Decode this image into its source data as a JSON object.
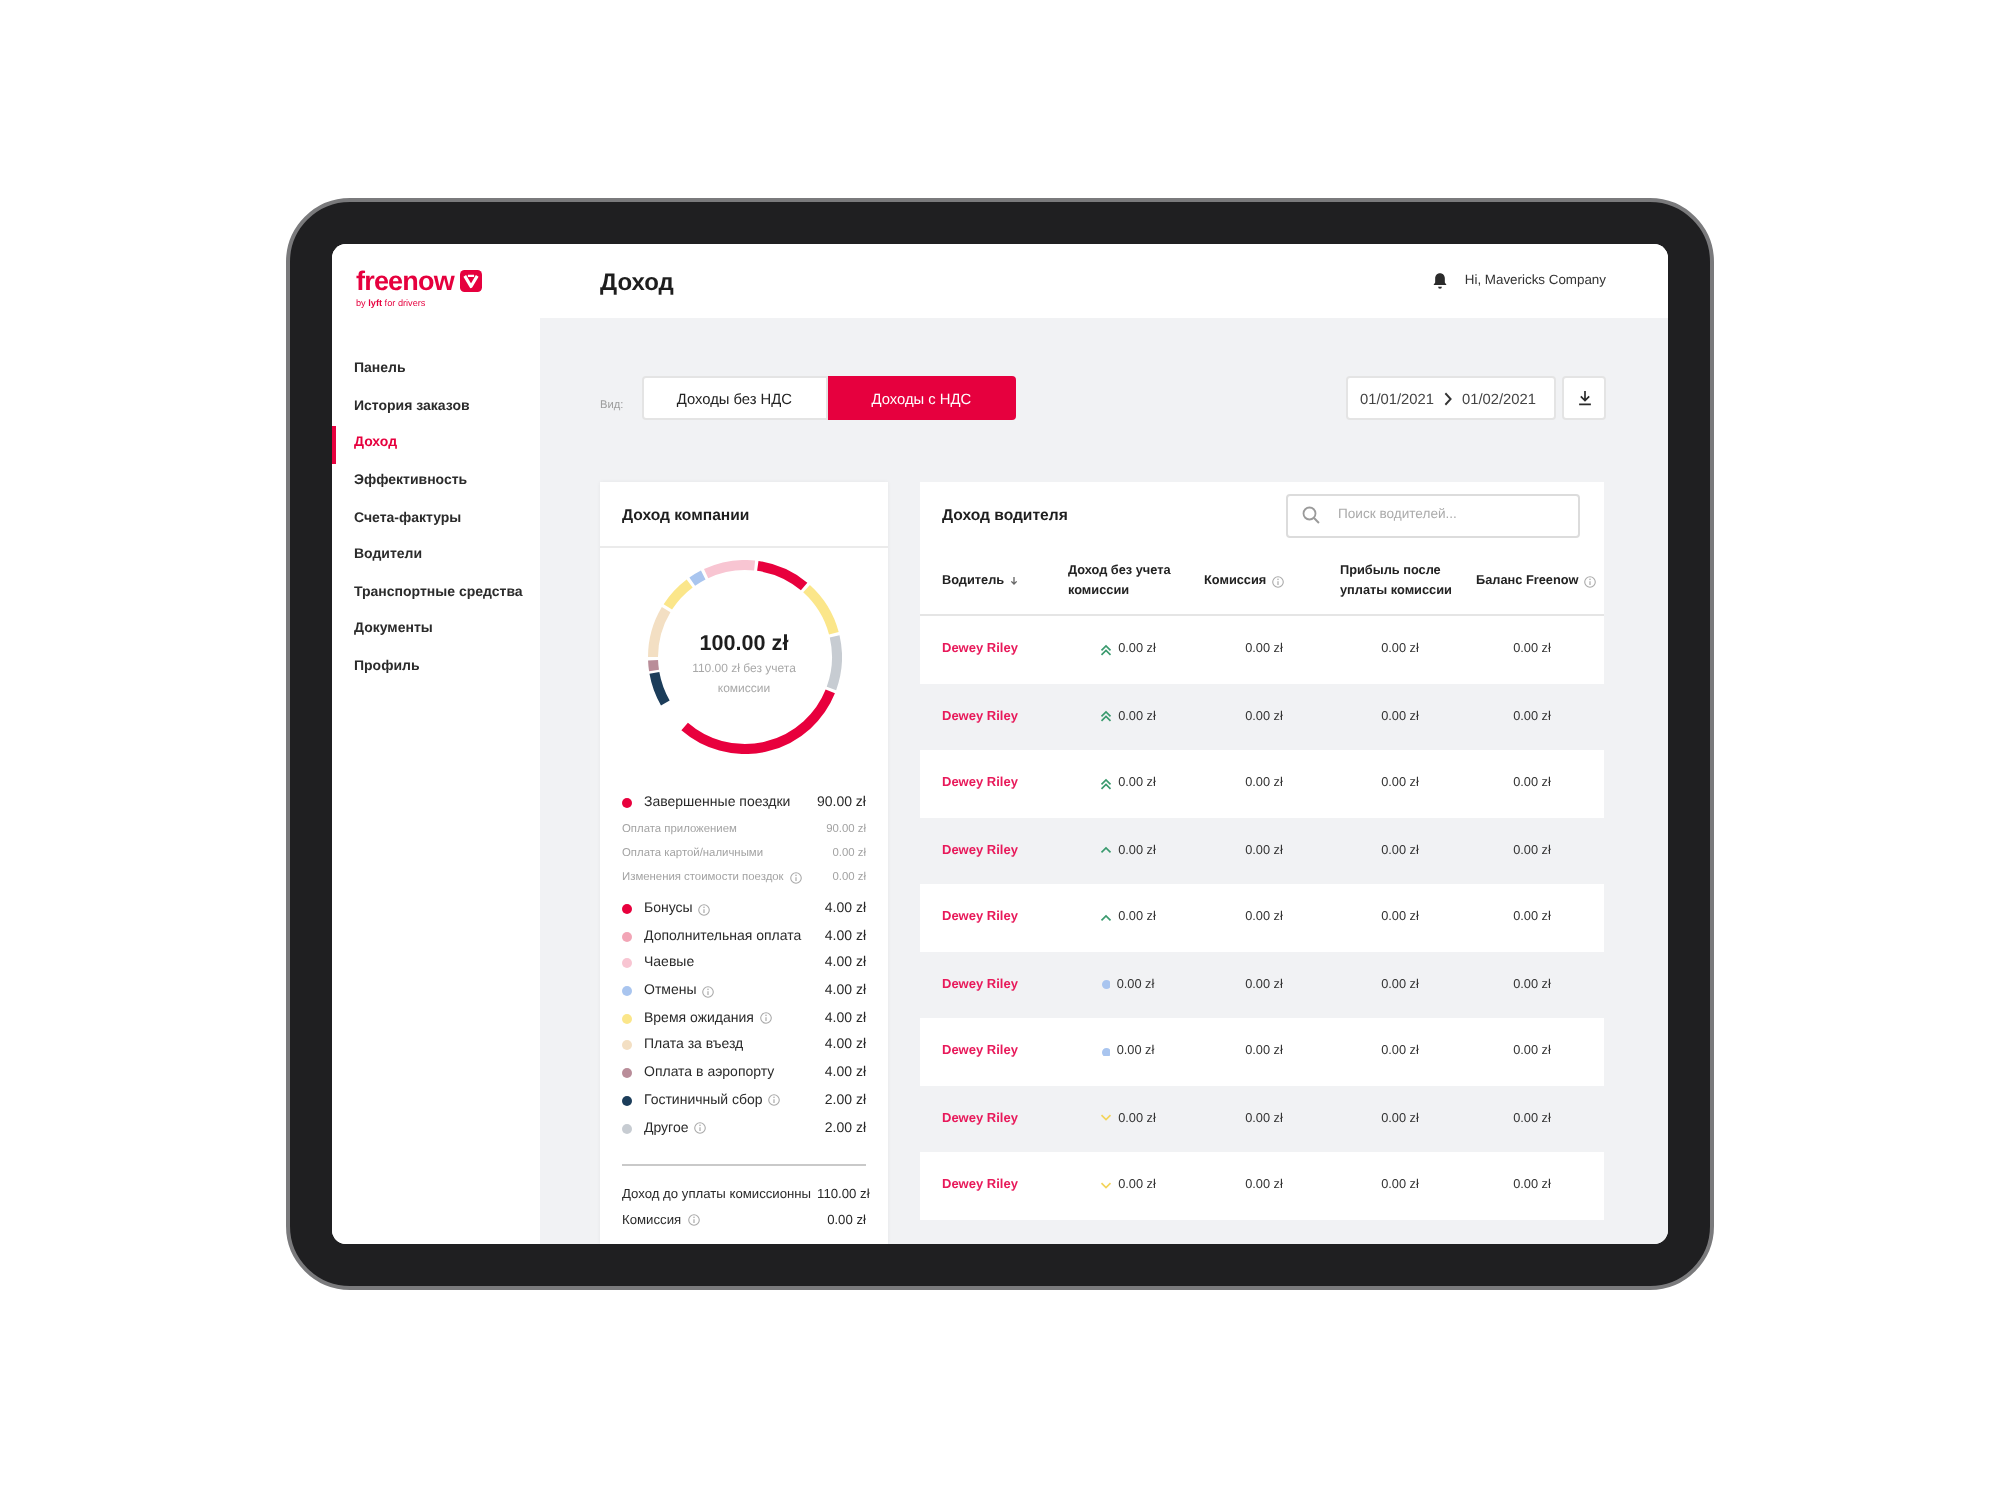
{
  "logo": {
    "wordmark": "freenow",
    "tagline": "by **lyft** for drivers"
  },
  "sidebar": {
    "items": [
      {
        "label": "Панель",
        "selected": false
      },
      {
        "label": "История заказов",
        "selected": false
      },
      {
        "label": "Доход",
        "selected": true
      },
      {
        "label": "Эффективность",
        "selected": false
      },
      {
        "label": "Счета-фактуры",
        "selected": false
      },
      {
        "label": "Водители",
        "selected": false
      },
      {
        "label": "Транспортные средства",
        "selected": false
      },
      {
        "label": "Документы",
        "selected": false
      },
      {
        "label": "Профиль",
        "selected": false
      }
    ]
  },
  "header": {
    "title": "Доход",
    "greeting": "Hi, Mavericks Company"
  },
  "toolbar": {
    "view_label": "Вид:",
    "view_options": [
      {
        "label": "Доходы без НДС",
        "selected": false
      },
      {
        "label": "Доходы с НДС",
        "selected": true
      }
    ],
    "date_from": "01/01/2021",
    "date_to": "01/02/2021"
  },
  "company_income": {
    "title": "Доход компании",
    "total": "100.00 zł",
    "total_note": "110.00 zł без учета комиссии",
    "breakdown": [
      {
        "label": "Завершенные поездки",
        "value": "90.00 zł",
        "color": "#e8003d",
        "info": false,
        "children": [
          {
            "label": "Оплата приложением",
            "value": "90.00 zł",
            "info": false
          },
          {
            "label": "Оплата картой/наличными",
            "value": "0.00 zł",
            "info": false
          },
          {
            "label": "Изменения стоимости поездок",
            "value": "0.00 zł",
            "info": true
          }
        ]
      },
      {
        "label": "Бонусы",
        "value": "4.00 zł",
        "color": "#e8003d",
        "info": true
      },
      {
        "label": "Дополнительная оплата",
        "value": "4.00 zł",
        "color": "#f2a5b6",
        "info": false
      },
      {
        "label": "Чаевые",
        "value": "4.00 zł",
        "color": "#f8c5d2",
        "info": false
      },
      {
        "label": "Отмены",
        "value": "4.00 zł",
        "color": "#a9c5ef",
        "info": true
      },
      {
        "label": "Время ожидания",
        "value": "4.00 zł",
        "color": "#fbe68a",
        "info": true
      },
      {
        "label": "Плата за въезд",
        "value": "4.00 zł",
        "color": "#f3dfc3",
        "info": false
      },
      {
        "label": "Оплата в аэропорту",
        "value": "4.00 zł",
        "color": "#b98d99",
        "info": false
      },
      {
        "label": "Гостиничный сбор",
        "value": "2.00 zł",
        "color": "#1c3d5a",
        "info": true
      },
      {
        "label": "Другое",
        "value": "2.00 zł",
        "color": "#c7ccd2",
        "info": true
      }
    ],
    "summary": [
      {
        "label": "Доход до уплаты комиссионны",
        "value": "110.00 zł",
        "info": false
      },
      {
        "label": "Комиссия",
        "value": "0.00 zł",
        "info": true
      }
    ]
  },
  "driver_income": {
    "title": "Доход водителя",
    "search_placeholder": "Поиск водителей...",
    "columns": [
      {
        "label": "Водитель",
        "sorted": true,
        "info": false
      },
      {
        "label": "Доход без учета комиссии",
        "sorted": false,
        "info": false
      },
      {
        "label": "Комиссия",
        "sorted": false,
        "info": true
      },
      {
        "label": "Прибыль после уплаты комиссии",
        "sorted": false,
        "info": false
      },
      {
        "label": "Баланс Freenow",
        "sorted": false,
        "info": true
      }
    ],
    "rows": [
      {
        "kind": "double_up",
        "cells": [
          "Dewey Riley",
          "0.00 zł",
          "0.00 zł",
          "0.00 zł",
          "0.00 zł"
        ]
      },
      {
        "kind": "double_up",
        "cells": [
          "Dewey Riley",
          "0.00 zł",
          "0.00 zł",
          "0.00 zł",
          "0.00 zł"
        ]
      },
      {
        "kind": "double_up",
        "cells": [
          "Dewey Riley",
          "0.00 zł",
          "0.00 zł",
          "0.00 zł",
          "0.00 zł"
        ]
      },
      {
        "kind": "up",
        "cells": [
          "Dewey Riley",
          "0.00 zł",
          "0.00 zł",
          "0.00 zł",
          "0.00 zł"
        ]
      },
      {
        "kind": "up",
        "cells": [
          "Dewey Riley",
          "0.00 zł",
          "0.00 zł",
          "0.00 zł",
          "0.00 zł"
        ]
      },
      {
        "kind": "flat",
        "cells": [
          "Dewey Riley",
          "0.00 zł",
          "0.00 zł",
          "0.00 zł",
          "0.00 zł"
        ]
      },
      {
        "kind": "flat",
        "cells": [
          "Dewey Riley",
          "0.00 zł",
          "0.00 zł",
          "0.00 zł",
          "0.00 zł"
        ]
      },
      {
        "kind": "down",
        "cells": [
          "Dewey Riley",
          "0.00 zł",
          "0.00 zł",
          "0.00 zł",
          "0.00 zł"
        ]
      },
      {
        "kind": "down",
        "cells": [
          "Dewey Riley",
          "0.00 zł",
          "0.00 zł",
          "0.00 zł",
          "0.00 zł"
        ]
      }
    ]
  }
}
